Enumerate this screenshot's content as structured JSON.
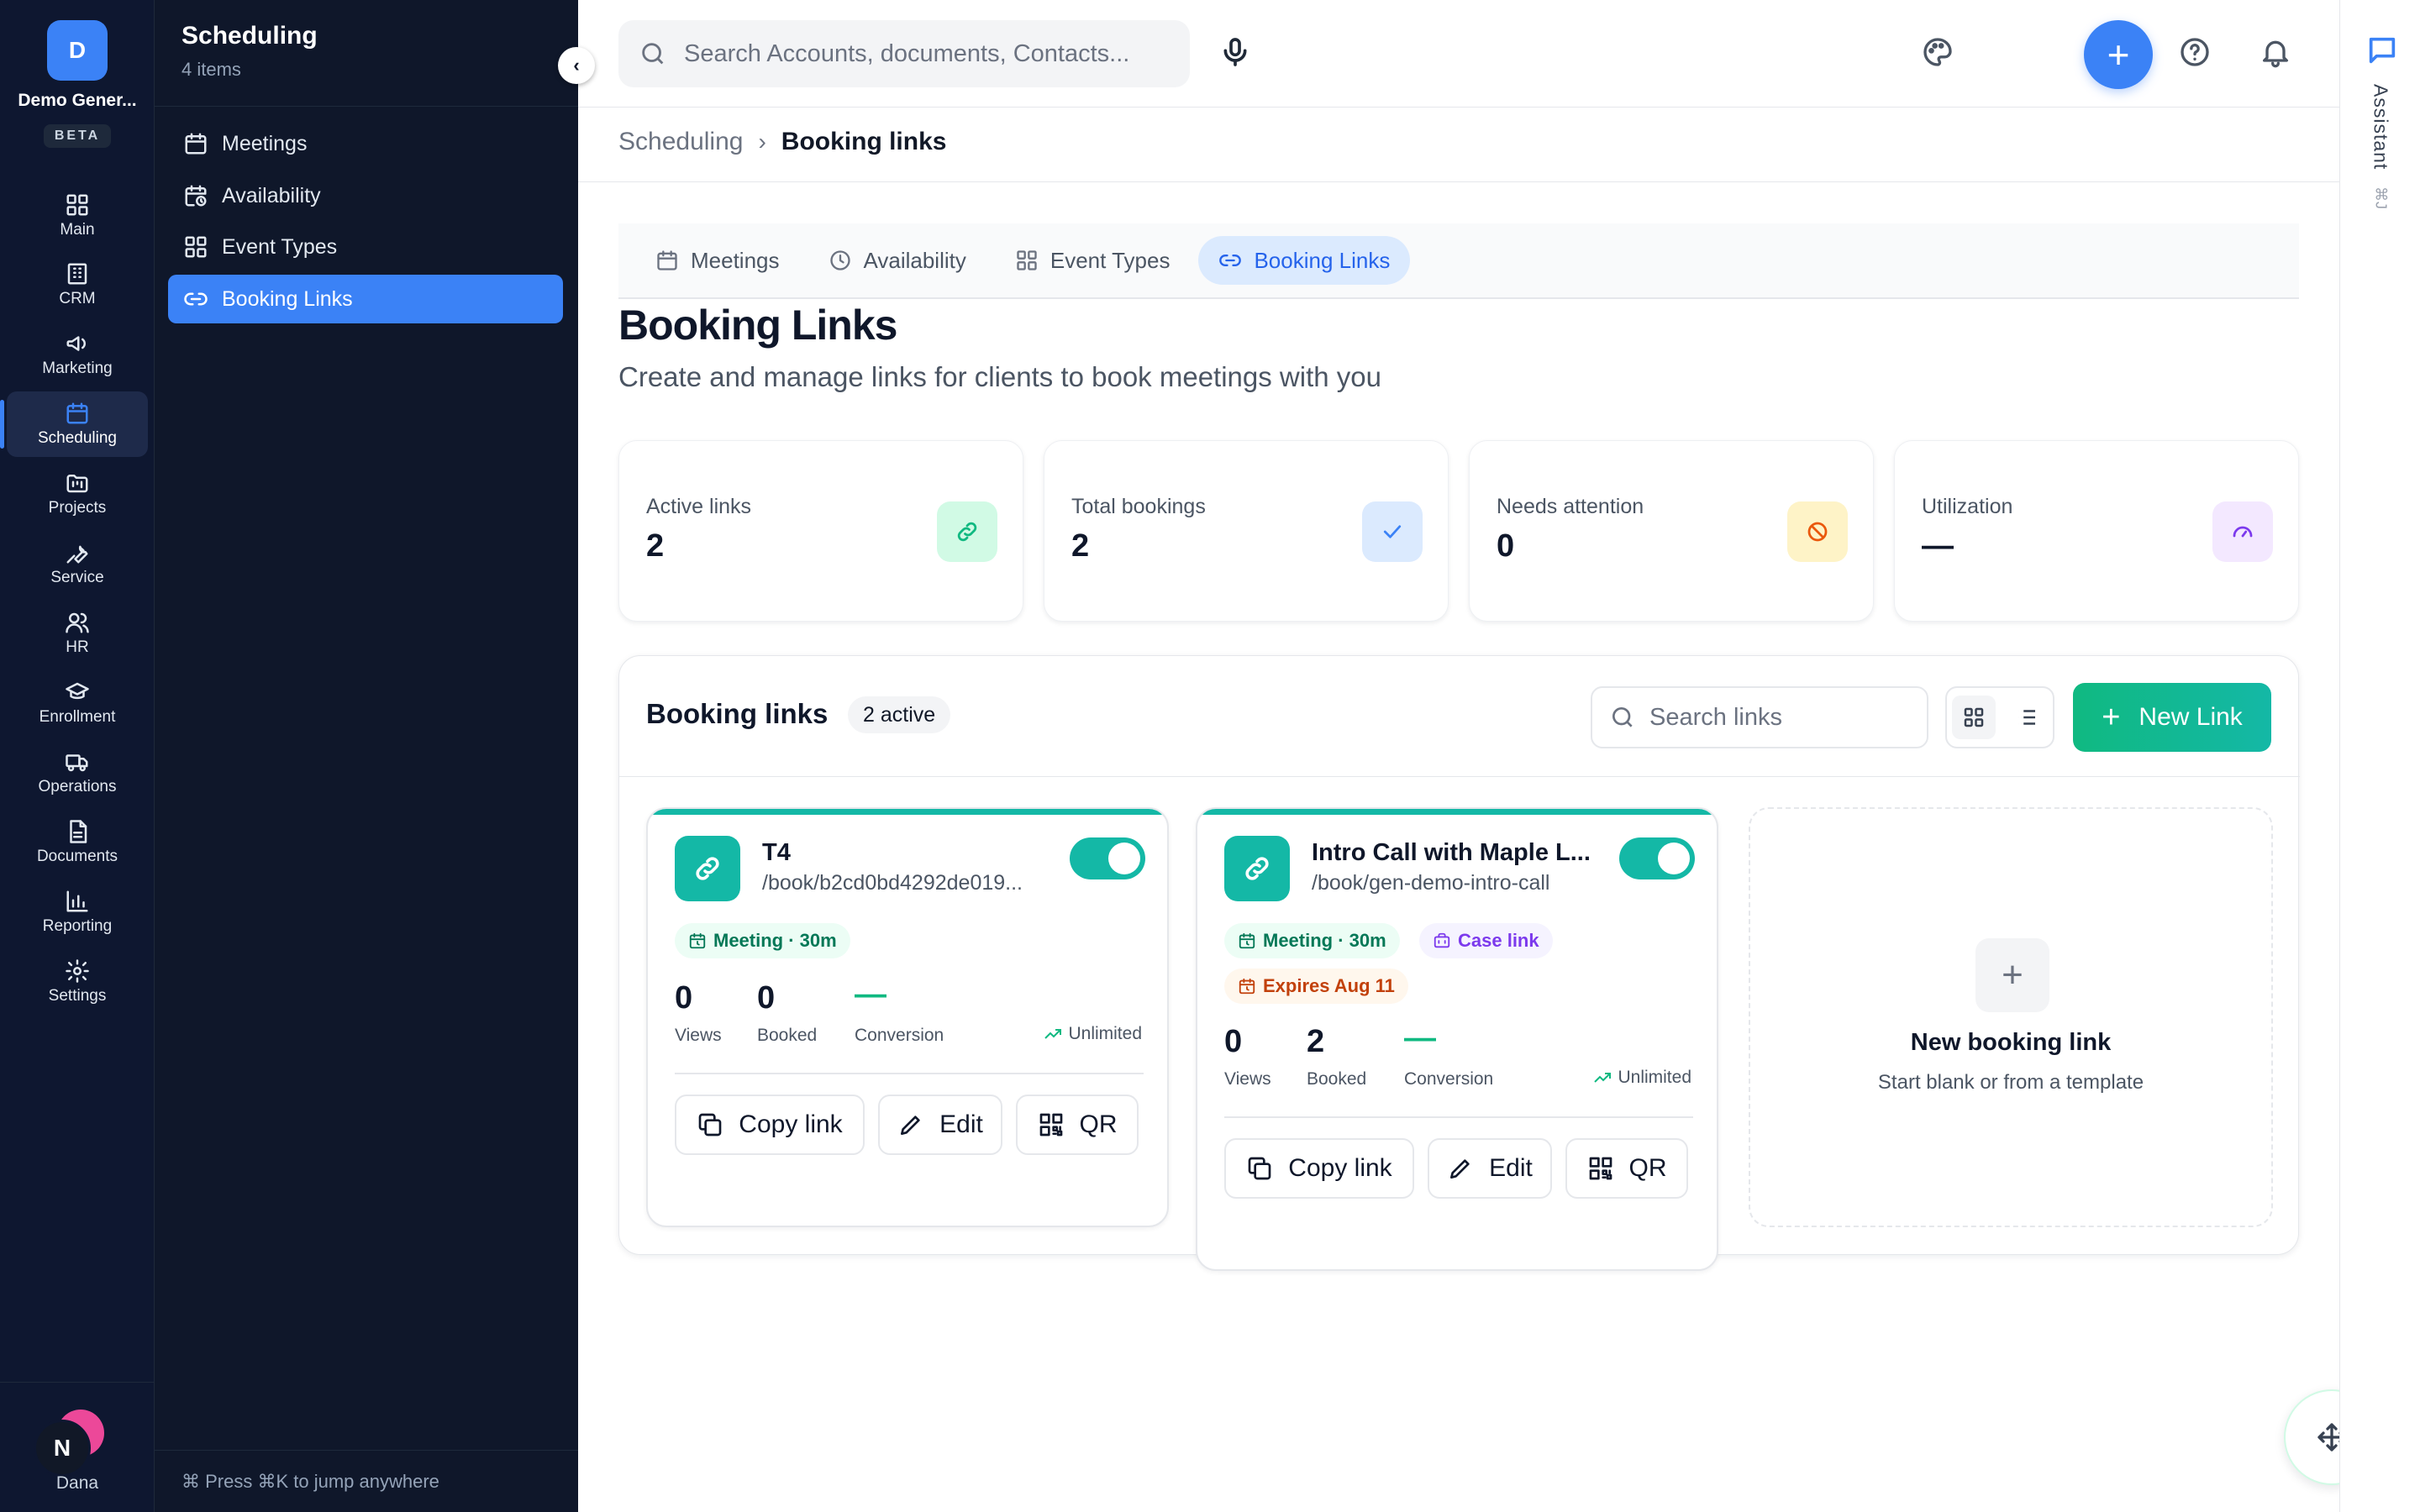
{
  "workspace": {
    "initial": "D",
    "name": "Demo Gener...",
    "badge": "BETA"
  },
  "rail": {
    "items": [
      {
        "label": "Main",
        "icon": "grid-icon"
      },
      {
        "label": "CRM",
        "icon": "building-icon"
      },
      {
        "label": "Marketing",
        "icon": "megaphone-icon"
      },
      {
        "label": "Scheduling",
        "icon": "calendar-icon",
        "active": true
      },
      {
        "label": "Projects",
        "icon": "folder-kanban-icon"
      },
      {
        "label": "Service",
        "icon": "wrench-icon"
      },
      {
        "label": "HR",
        "icon": "users-icon"
      },
      {
        "label": "Enrollment",
        "icon": "graduation-cap-icon"
      },
      {
        "label": "Operations",
        "icon": "truck-icon"
      },
      {
        "label": "Documents",
        "icon": "file-text-icon"
      },
      {
        "label": "Reporting",
        "icon": "bar-chart-icon"
      },
      {
        "label": "Settings",
        "icon": "gear-icon"
      }
    ],
    "user": {
      "initial": "N",
      "name": "Dana"
    }
  },
  "subnav": {
    "title": "Scheduling",
    "count": "4 items",
    "collapse_glyph": "‹",
    "items": [
      {
        "label": "Meetings",
        "icon": "calendar-icon"
      },
      {
        "label": "Availability",
        "icon": "calendar-clock-icon"
      },
      {
        "label": "Event Types",
        "icon": "grid-icon"
      },
      {
        "label": "Booking Links",
        "icon": "link-icon",
        "active": true
      }
    ],
    "footer": "⌘  Press ⌘K to jump anywhere"
  },
  "topbar": {
    "search_placeholder": "Search Accounts, documents, Contacts...",
    "plus_glyph": "+",
    "icons": [
      "mic-icon",
      "palette-icon",
      "help-icon",
      "bell-icon"
    ]
  },
  "breadcrumb": {
    "root": "Scheduling",
    "separator": "›",
    "current": "Booking links"
  },
  "tabs": [
    {
      "label": "Meetings",
      "icon": "calendar-icon"
    },
    {
      "label": "Availability",
      "icon": "clock-icon"
    },
    {
      "label": "Event Types",
      "icon": "grid-icon"
    },
    {
      "label": "Booking Links",
      "icon": "link-icon",
      "active": true
    }
  ],
  "page": {
    "title": "Booking Links",
    "subtitle": "Create and manage links for clients to book meetings with you"
  },
  "stats": [
    {
      "label": "Active links",
      "value": "2",
      "icon": "link-icon",
      "bg": "#d1fae5",
      "color": "#10b981"
    },
    {
      "label": "Total bookings",
      "value": "2",
      "icon": "check-icon",
      "bg": "#dbeafe",
      "color": "#3b82f6"
    },
    {
      "label": "Needs attention",
      "value": "0",
      "icon": "ban-icon",
      "bg": "#fef3c7",
      "color": "#ea580c"
    },
    {
      "label": "Utilization",
      "value": "—",
      "icon": "gauge-icon",
      "bg": "#f3e8ff",
      "color": "#7c3aed"
    }
  ],
  "panel": {
    "title": "Booking links",
    "badge": "2 active",
    "search_placeholder": "Search links",
    "new_button": "New Link",
    "new_glyph": "+"
  },
  "cards": [
    {
      "name": "T4",
      "url": "/book/b2cd0bd4292de019...",
      "enabled": true,
      "chips": [
        {
          "label": "Meeting · 30m",
          "kind": "meeting"
        }
      ],
      "metrics": [
        {
          "value": "0",
          "label": "Views"
        },
        {
          "value": "0",
          "label": "Booked"
        },
        {
          "value": "—",
          "label": "Conversion"
        }
      ],
      "limit": "Unlimited",
      "actions": [
        "Copy link",
        "Edit",
        "QR"
      ]
    },
    {
      "name": "Intro Call with Maple L...",
      "url": "/book/gen-demo-intro-call",
      "enabled": true,
      "chips": [
        {
          "label": "Meeting · 30m",
          "kind": "meeting"
        },
        {
          "label": "Case link",
          "kind": "case"
        },
        {
          "label": "Expires Aug 11",
          "kind": "expires"
        }
      ],
      "metrics": [
        {
          "value": "0",
          "label": "Views"
        },
        {
          "value": "2",
          "label": "Booked"
        },
        {
          "value": "—",
          "label": "Conversion"
        }
      ],
      "limit": "Unlimited",
      "actions": [
        "Copy link",
        "Edit",
        "QR"
      ]
    }
  ],
  "new_card": {
    "plus_glyph": "+",
    "title": "New booking link",
    "subtitle": "Start blank or from a template"
  },
  "assistant": {
    "label": "Assistant",
    "shortcut": "⌘J"
  }
}
